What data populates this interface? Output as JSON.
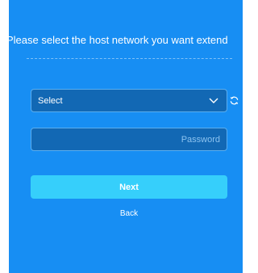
{
  "heading": "Please select the host network you want extend",
  "network_select": {
    "value": "Select",
    "icon": "chevron-down-icon"
  },
  "refresh_icon": "refresh-icon",
  "password_field": {
    "value": "",
    "placeholder": "Password"
  },
  "actions": {
    "next_label": "Next",
    "back_label": "Back"
  },
  "colors": {
    "panel_background": "#178ef3",
    "field_background": "#1268b4",
    "field_border": "#5aaef0",
    "primary_button": "#36cffb",
    "text": "#ffffff"
  }
}
